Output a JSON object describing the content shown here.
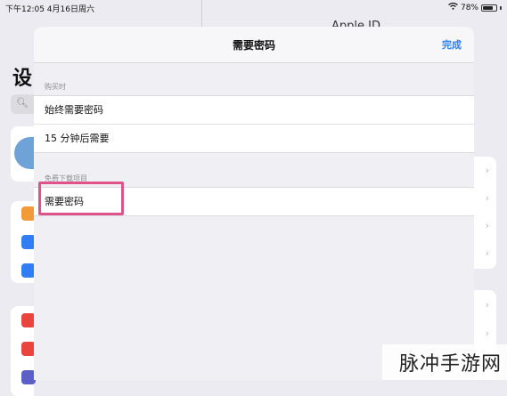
{
  "status_bar": {
    "time_date": "下午12:05  4月16日周六",
    "battery": "78%",
    "battery_level": 0.78
  },
  "background": {
    "settings_title_partial": "设",
    "right_pane_title_partial": "Apple ID"
  },
  "sheet": {
    "title": "需要密码",
    "done_label": "完成",
    "sections": [
      {
        "header": "购买时",
        "rows": [
          "始终需要密码",
          "15 分钟后需要"
        ]
      },
      {
        "header": "免费下载项目",
        "rows": [
          "需要密码"
        ]
      }
    ]
  },
  "watermark": "脉冲手游网",
  "colors": {
    "accent": "#2f7ff3",
    "highlight": "#e0528a"
  }
}
